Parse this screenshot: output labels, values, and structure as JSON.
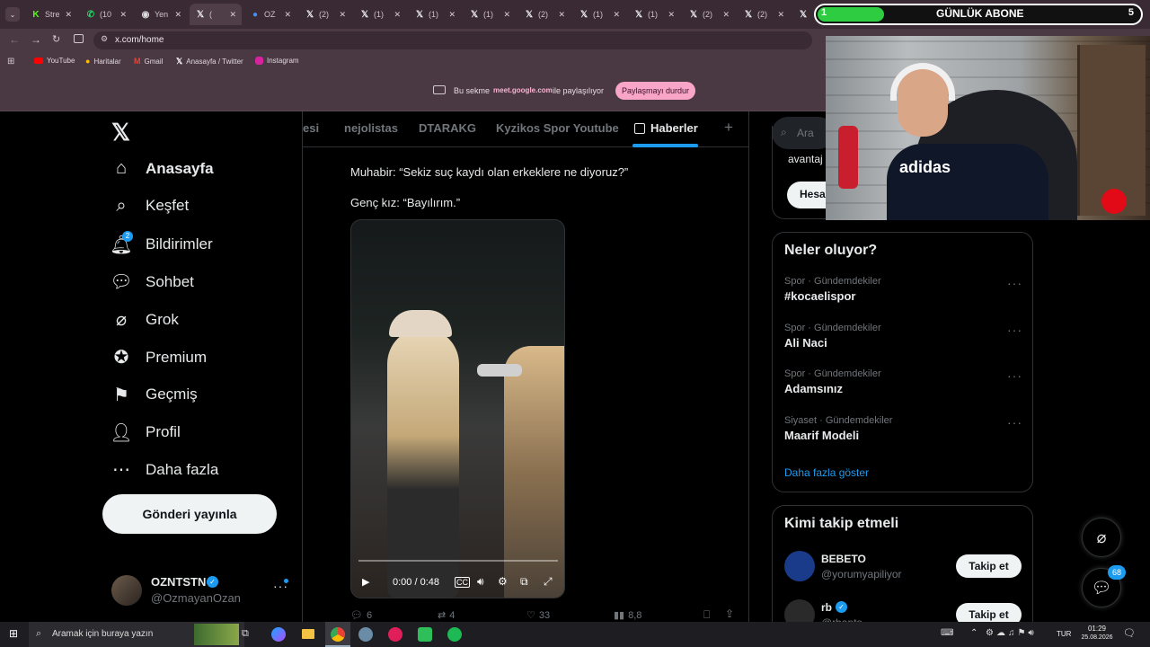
{
  "browser": {
    "tabs": [
      {
        "label": "Stre",
        "icon": "kick-icon"
      },
      {
        "label": "(10",
        "icon": "whatsapp-icon"
      },
      {
        "label": "Yen",
        "icon": "chrome-icon"
      },
      {
        "label": "(",
        "icon": "x-icon"
      },
      {
        "label": "OZ",
        "icon": "globe-icon"
      },
      {
        "label": "(2)",
        "icon": "x-icon"
      },
      {
        "label": "(1)",
        "icon": "x-icon"
      },
      {
        "label": "(1)",
        "icon": "x-icon"
      },
      {
        "label": "(1)",
        "icon": "x-icon"
      },
      {
        "label": "(2)",
        "icon": "x-icon"
      },
      {
        "label": "(1)",
        "icon": "x-icon"
      },
      {
        "label": "(1)",
        "icon": "x-icon"
      },
      {
        "label": "(2)",
        "icon": "x-icon"
      },
      {
        "label": "(2)",
        "icon": "x-icon"
      },
      {
        "label": "(2)",
        "icon": "x-icon"
      }
    ],
    "url": "x.com/home",
    "bookmarks": [
      "YouTube",
      "Haritalar",
      "Gmail",
      "Anasayfa / Twitter",
      "Instagram"
    ],
    "share": {
      "prefix": "Bu sekme",
      "domain": "meet.google.com",
      "suffix": "ile paylaşılıyor",
      "stop_label": "Paylaşmayı durdur"
    }
  },
  "overlay": {
    "goal_current": "1",
    "goal_label": "GÜNLÜK ABONE",
    "goal_target": "5"
  },
  "sidebar": {
    "items": [
      {
        "label": "Anasayfa",
        "icon": "home-icon"
      },
      {
        "label": "Keşfet",
        "icon": "search-icon"
      },
      {
        "label": "Bildirimler",
        "icon": "bell-icon",
        "badge": "2"
      },
      {
        "label": "Sohbet",
        "icon": "chat-icon"
      },
      {
        "label": "Grok",
        "icon": "grok-icon"
      },
      {
        "label": "Premium",
        "icon": "premium-icon"
      },
      {
        "label": "Geçmiş",
        "icon": "bookmark-icon"
      },
      {
        "label": "Profil",
        "icon": "user-icon"
      },
      {
        "label": "Daha fazla",
        "icon": "more-circle-icon"
      }
    ],
    "post_button": "Gönderi yayınla",
    "account": {
      "name": "OZNTSTN",
      "handle": "@OzmayanOzan"
    }
  },
  "timeline": {
    "tabs": [
      "esi",
      "nejolistas",
      "DTARAKG",
      "Kyzikos Spor Youtube",
      "Haberler"
    ],
    "active_tab": "Haberler",
    "text_line1": "Muhabir: “Sekiz suç kaydı olan erkeklere ne diyoruz?”",
    "text_line2": "Genç kız: “Bayılırım.”",
    "video": {
      "time": "0:00 / 0:48"
    },
    "actions": {
      "replies": "6",
      "reposts": "4",
      "likes": "33",
      "views": "8,8"
    }
  },
  "right": {
    "search_placeholder": "Ara",
    "partial_text": "avantaj",
    "partial_button": "Hesa",
    "trends_title": "Neler oluyor?",
    "trends": [
      {
        "category": "Spor · Gündemdekiler",
        "name": "#kocaelispor"
      },
      {
        "category": "Spor · Gündemdekiler",
        "name": "Ali Naci"
      },
      {
        "category": "Spor · Gündemdekiler",
        "name": "Adamsınız"
      },
      {
        "category": "Siyaset · Gündemdekiler",
        "name": "Maarif Modeli"
      }
    ],
    "show_more": "Daha fazla göster",
    "follow_title": "Kimi takip etmeli",
    "follow": [
      {
        "name": "BEBETO",
        "handle": "@yorumyapiliyor",
        "button": "Takip et"
      },
      {
        "name": "rb",
        "handle": "@rbapts",
        "button": "Takip et"
      }
    ],
    "chat_badge": "68"
  },
  "webcam": {
    "shirt_text": "adidas"
  },
  "taskbar": {
    "search_placeholder": "Aramak için buraya yazın",
    "lang": "TUR",
    "time": "01:29",
    "date": "25.08.2026"
  },
  "colors": {
    "accent": "#1d9bf0",
    "share_pill": "#f8a5c8",
    "goal_green": "#2ecc40"
  }
}
